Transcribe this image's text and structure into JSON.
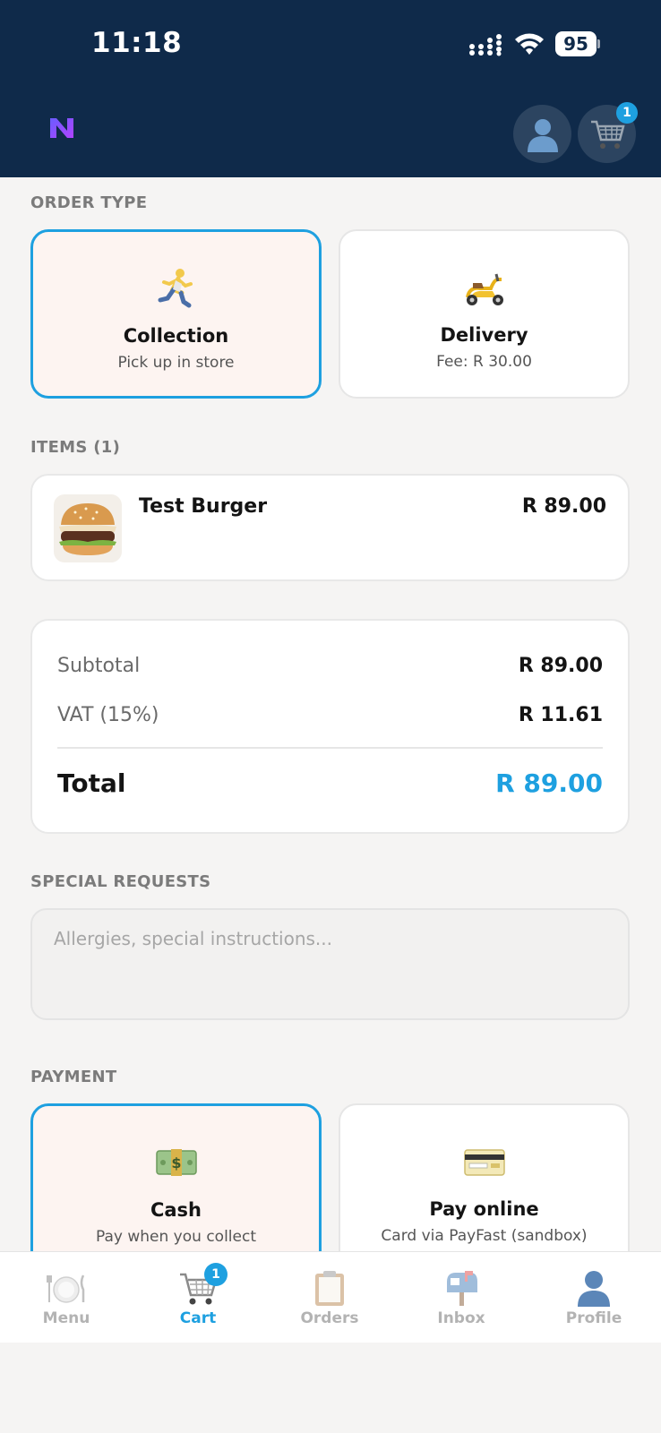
{
  "status_bar": {
    "time": "11:18",
    "battery": "95"
  },
  "header": {
    "cart_badge": "1",
    "profile_icon": "profile-icon",
    "cart_icon": "cart-icon"
  },
  "order_type": {
    "label": "ORDER TYPE",
    "options": [
      {
        "title": "Collection",
        "subtitle": "Pick up in store",
        "icon": "runner-icon",
        "selected": true
      },
      {
        "title": "Delivery",
        "subtitle": "Fee: R 30.00",
        "icon": "scooter-icon",
        "selected": false
      }
    ]
  },
  "items": {
    "label": "ITEMS (1)",
    "list": [
      {
        "name": "Test Burger",
        "price": "R 89.00",
        "image": "burger-image"
      }
    ]
  },
  "totals": {
    "subtotal_label": "Subtotal",
    "subtotal_value": "R 89.00",
    "vat_label": "VAT (15%)",
    "vat_value": "R 11.61",
    "total_label": "Total",
    "total_value": "R 89.00"
  },
  "special_requests": {
    "label": "SPECIAL REQUESTS",
    "placeholder": "Allergies, special instructions...",
    "value": ""
  },
  "payment": {
    "label": "PAYMENT",
    "options": [
      {
        "title": "Cash",
        "subtitle": "Pay when you collect",
        "icon": "cash-icon",
        "selected": true
      },
      {
        "title": "Pay online",
        "subtitle": "Card via PayFast (sandbox)",
        "icon": "card-icon",
        "selected": false
      }
    ]
  },
  "bottom_nav": {
    "items": [
      {
        "label": "Menu",
        "icon": "plate-icon",
        "active": false
      },
      {
        "label": "Cart",
        "icon": "cart-icon",
        "active": true,
        "badge": "1"
      },
      {
        "label": "Orders",
        "icon": "clipboard-icon",
        "active": false
      },
      {
        "label": "Inbox",
        "icon": "mailbox-icon",
        "active": false
      },
      {
        "label": "Profile",
        "icon": "profile-icon",
        "active": false
      }
    ]
  },
  "colors": {
    "header_bg": "#0f2a4a",
    "accent": "#1ea0e0",
    "selected_bg": "#fdf4f1",
    "page_bg": "#f5f4f3"
  }
}
